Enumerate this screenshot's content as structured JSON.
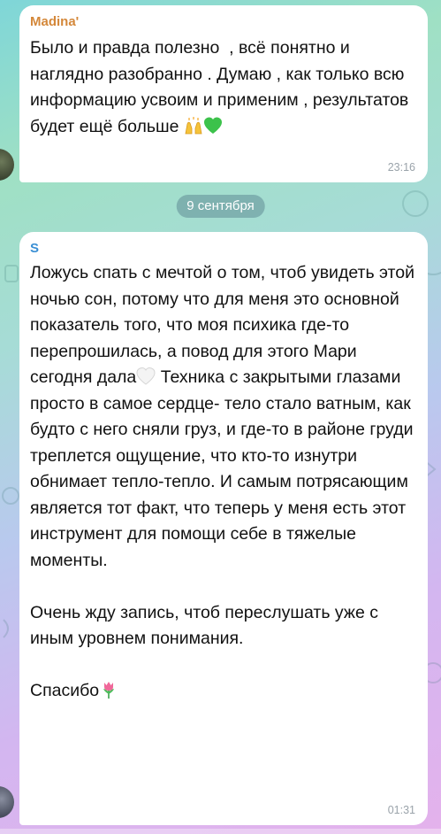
{
  "messages": [
    {
      "sender": "Madina'",
      "text_before": "Было и правда полезно  , всё понятно и наглядно разобранно . Думаю , как только всю информацию усвоим и применим , результатов будет ещё больше ",
      "time": "23:16",
      "emojis": [
        "raising-hands-emoji",
        "green-heart-emoji"
      ]
    },
    {
      "sender": "S",
      "text_part1": "Ложусь спать с мечтой о том, чтоб увидеть этой ночью сон, потому что для меня это основной показатель того, что моя психика где-то перепрошилась, а повод для этого Мари сегодня дала",
      "text_part2": " Техника с закрытыми глазами просто в самое сердце- тело стало ватным, как будто с него сняли груз, и где-то в районе груди треплется ощущение, что кто-то изнутри обнимает тепло-тепло. И самым потрясающим является тот факт, что теперь у меня есть этот инструмент для помощи себе в тяжелые моменты.\n\nОчень жду запись, чтоб переслушать уже с иным уровнем понимания.\n\nСпасибо",
      "time": "01:31",
      "emojis": [
        "white-heart-emoji",
        "tulip-emoji"
      ]
    }
  ],
  "date_separator": "9 сентября",
  "colors": {
    "sender1": "#d4883a",
    "sender2": "#3a8fd4",
    "bubble": "#ffffff",
    "time": "#9aa3aa"
  }
}
